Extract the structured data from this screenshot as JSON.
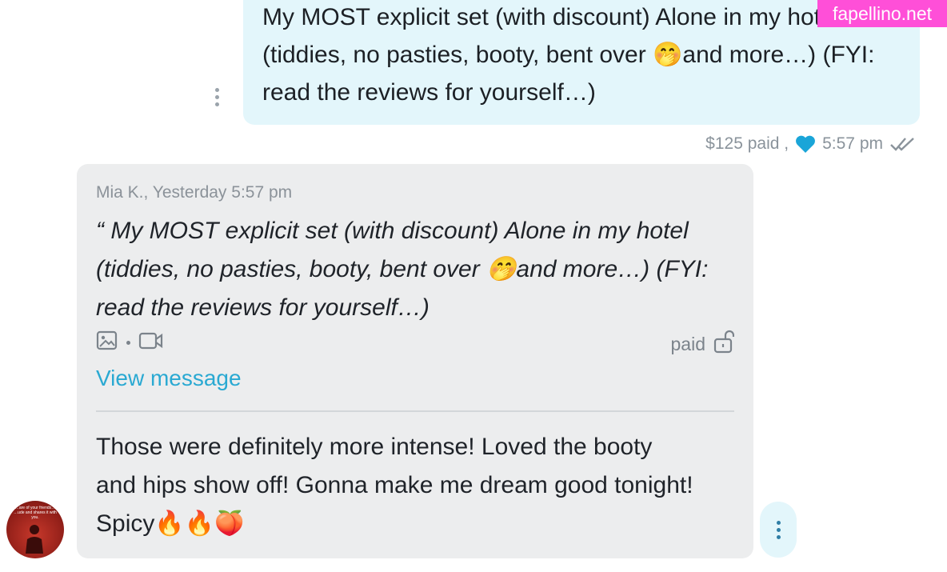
{
  "sent_message": {
    "text": "My MOST explicit set (with discount) Alone in my hotel\n(tiddies, no pasties, booty, bent over 🤭and more…) (FYI:\nread the reviews for yourself…)",
    "price": "$125 paid ,",
    "time": "5:57 pm",
    "heart_color": "#1aa5d8"
  },
  "received_message": {
    "quote_header": "Mia K., Yesterday 5:57 pm",
    "quote_text": "“ My MOST explicit set (with discount) Alone in my hotel\n(tiddies, no pasties, booty, bent over 🤭and more…) (FYI:\nread the reviews for yourself…)",
    "paid_label": "paid",
    "view_label": "View message",
    "reply_text": "Those were definitely more intense! Loved the booty\nand hips show off! Gonna make me dream good tonight!\nSpicy🔥🔥🍑"
  },
  "avatar": {
    "caption": "…are of your friends…\n…ude and shares it with you."
  },
  "watermark": "fapellino.net",
  "icons": [
    "more-vertical-icon",
    "heart-icon",
    "double-check-icon",
    "image-icon",
    "video-icon",
    "unlock-icon"
  ],
  "colors": {
    "accent": "#2aa9d2",
    "sent_bubble": "#e3f6fb",
    "received_bubble": "#ecedee"
  }
}
